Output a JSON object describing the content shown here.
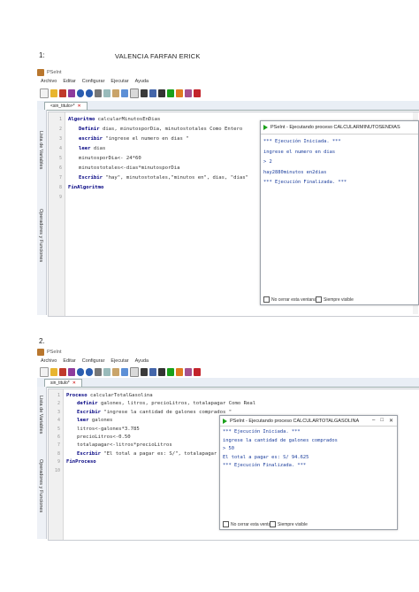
{
  "heading": {
    "number": "1:",
    "author": "VALENCIA FARFAN ERICK"
  },
  "section2": {
    "number": "2."
  },
  "app": {
    "title": "PSeInt",
    "menu": [
      "Archivo",
      "Editar",
      "Configurar",
      "Ejecutar",
      "Ayuda"
    ],
    "side_panel_1": "Lista de Variables",
    "side_panel_2": "Operadores y Funciones"
  },
  "shot1": {
    "tab": "<sin_titulo>*",
    "lines": [
      "1",
      "2",
      "3",
      "4",
      "5",
      "6",
      "7",
      "8",
      "9"
    ],
    "code": [
      {
        "kw": "Algoritmo",
        "rest": " calcularMinutosEnDias"
      },
      {
        "kw": "Definir",
        "rest": " dias, minutosporDia, minutostotales Como Entero"
      },
      {
        "kw": "escribir",
        "rest": " \"ingrese el numero en dias \""
      },
      {
        "kw": "leer",
        "rest": " dias"
      },
      {
        "kw": "",
        "rest": "minutosporDia<- 24*60"
      },
      {
        "kw": "",
        "rest": "minutostotales<-dias*minutosporDia"
      },
      {
        "kw": "Escribir",
        "rest": " \"hay\", minutostotales,\"minutos en\", dias, \"dias\""
      },
      {
        "kw": "FinAlgoritmo",
        "rest": ""
      },
      {
        "kw": "",
        "rest": ""
      }
    ],
    "exec_window": {
      "title": "PSeInt - Ejecutando proceso CALCULARMINUTOSENDIAS",
      "output": [
        "*** Ejecución Iniciada. ***",
        "ingrese el numero en dias",
        "> 2",
        "hay2880minutos en2dias",
        "*** Ejecución Finalizada. ***"
      ],
      "checkbox_close": "No cerrar esta ventana",
      "checkbox_top": "Siempre visible"
    }
  },
  "shot2": {
    "tab": "sin_titulo*",
    "lines": [
      "1",
      "2",
      "3",
      "4",
      "5",
      "6",
      "7",
      "8",
      "9",
      "10"
    ],
    "code": [
      {
        "kw": "Proceso",
        "rest": " calcularTotalGasolina"
      },
      {
        "kw": "definir",
        "rest": " galones, litros, precioLitros, totalapagar Como Real"
      },
      {
        "kw": "Escribir",
        "rest": " \"ingrese la cantidad de galones comprados \""
      },
      {
        "kw": "leer",
        "rest": " galones"
      },
      {
        "kw": "",
        "rest": "litros<-galones*3.785"
      },
      {
        "kw": "",
        "rest": "precioLitros<-0.50"
      },
      {
        "kw": "",
        "rest": "totalapagar<-litros*precioLitros"
      },
      {
        "kw": "Escribir",
        "rest": " \"El total a pagar es: S/\", totalapagar"
      },
      {
        "kw": "FinProceso",
        "rest": ""
      },
      {
        "kw": "",
        "rest": ""
      }
    ],
    "exec_window": {
      "title": "PSeInt - Ejecutando proceso CALCULARTOTALGASOLINA",
      "output": [
        "*** Ejecución Iniciada. ***",
        "ingrese la cantidad de galones comprados",
        "> 50",
        "El total a pagar es: S/ 94.625",
        "*** Ejecución Finalizada. ***"
      ],
      "checkbox_close": "No cerrar esta ventana",
      "checkbox_top": "Siempre visible"
    }
  },
  "colors": {
    "keyword": "#000080",
    "output": "#1a3d9c",
    "run": "#1aa01a"
  }
}
